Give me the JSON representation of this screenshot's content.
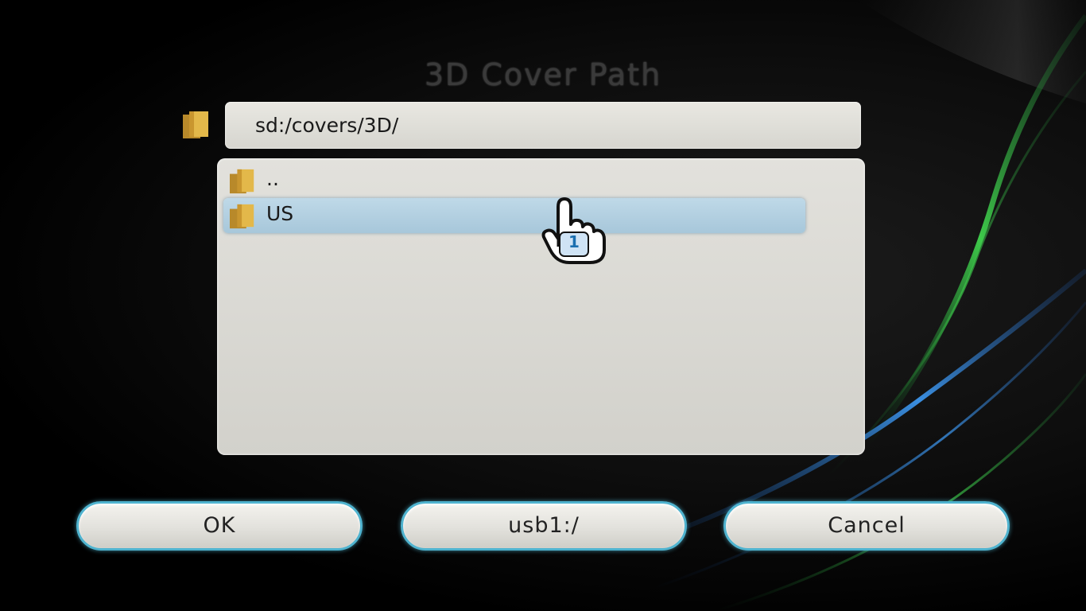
{
  "dialog": {
    "title": "3D Cover Path",
    "current_path": "sd:/covers/3D/"
  },
  "file_list": {
    "items": [
      {
        "label": "..",
        "icon": "folder-icon",
        "selected": false
      },
      {
        "label": "US",
        "icon": "folder-icon",
        "selected": true
      }
    ]
  },
  "buttons": {
    "ok_label": "OK",
    "usb_label": "usb1:/",
    "cancel_label": "Cancel"
  },
  "cursor": {
    "icon": "hand-pointer-icon",
    "player": "1"
  },
  "colors": {
    "button_border": "#4fb3cf",
    "selected_row": "#a7c7da",
    "folder": "#d9a93a"
  }
}
